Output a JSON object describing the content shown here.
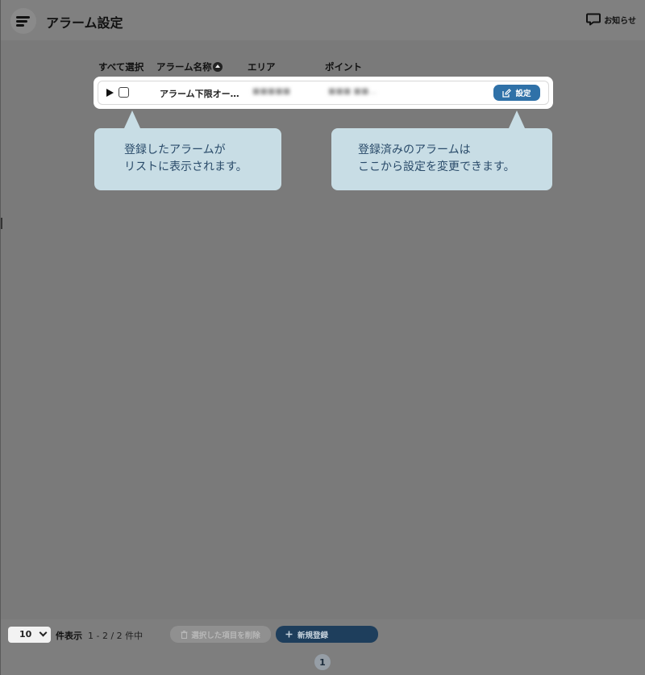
{
  "header": {
    "title": "アラーム設定",
    "notice_label": "お知らせ"
  },
  "table": {
    "columns": {
      "select_all": "すべて選択",
      "alarm_name": "アラーム名称",
      "area": "エリア",
      "point": "ポイント"
    },
    "rows": [
      {
        "alarm_name": "アラーム下限オー…",
        "area": "■■■■■",
        "point": "■■■ ■■…",
        "edit_label": "設定"
      }
    ]
  },
  "callouts": {
    "left": [
      "登録したアラームが",
      "リストに表示されます。"
    ],
    "right": [
      "登録済みのアラームは",
      "ここから設定を変更できます。"
    ]
  },
  "footer": {
    "per_page_value": "10",
    "per_page_label": "件表示",
    "range_text": "1 - 2 / 2 件中",
    "delete_label": "選択した項目を削除",
    "new_label": "新規登録",
    "current_page": "1"
  },
  "colors": {
    "overlay": "#7a7a7a",
    "accent": "#2f71a8",
    "callout": "#c8dde5",
    "new_button": "#1e3e5c"
  }
}
